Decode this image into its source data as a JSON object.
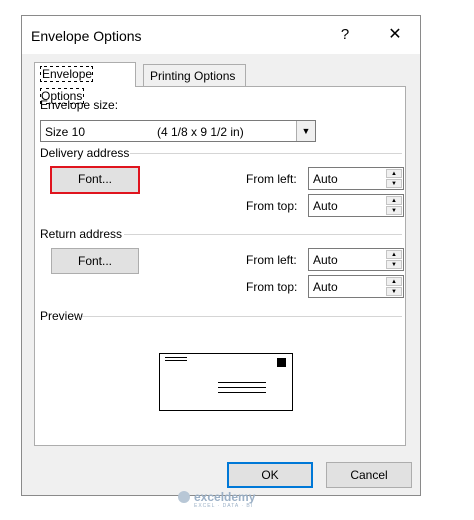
{
  "window": {
    "title": "Envelope Options",
    "help": "?",
    "close": "✕"
  },
  "tabs": [
    {
      "label": "Envelope Options",
      "active": true
    },
    {
      "label": "Printing Options",
      "active": false
    }
  ],
  "envelope_size": {
    "label": "Envelope size:",
    "selected_name": "Size 10",
    "selected_dims": "(4 1/8 x 9 1/2 in)"
  },
  "delivery": {
    "heading": "Delivery address",
    "font_button": "Font...",
    "from_left_label": "From left:",
    "from_left_value": "Auto",
    "from_top_label": "From top:",
    "from_top_value": "Auto"
  },
  "return": {
    "heading": "Return address",
    "font_button": "Font...",
    "from_left_label": "From left:",
    "from_left_value": "Auto",
    "from_top_label": "From top:",
    "from_top_value": "Auto"
  },
  "preview": {
    "heading": "Preview"
  },
  "footer": {
    "ok": "OK",
    "cancel": "Cancel"
  },
  "watermark": {
    "name": "exceldemy",
    "tag": "EXCEL · DATA · BI"
  },
  "colors": {
    "highlight": "#e0141e",
    "default_button_border": "#0078d7"
  }
}
